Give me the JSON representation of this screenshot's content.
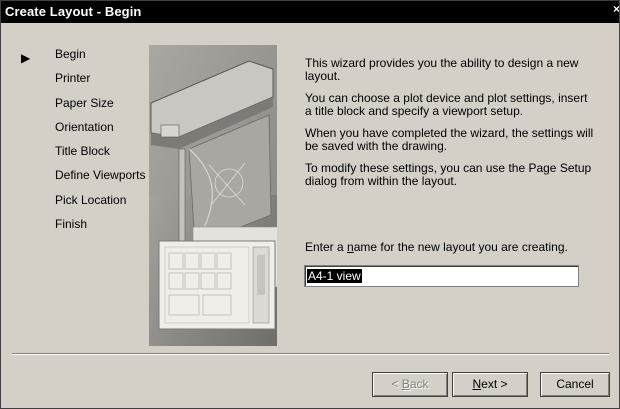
{
  "window": {
    "title": "Create Layout - Begin",
    "close_glyph": "×"
  },
  "steps": [
    {
      "label": "Begin",
      "current": true
    },
    {
      "label": "Printer"
    },
    {
      "label": "Paper Size"
    },
    {
      "label": "Orientation"
    },
    {
      "label": "Title Block"
    },
    {
      "label": "Define Viewports"
    },
    {
      "label": "Pick Location"
    },
    {
      "label": "Finish"
    }
  ],
  "current_marker": "▶",
  "main": {
    "paragraphs": [
      "This wizard provides you the ability to design a new layout.",
      "You can choose a plot device and plot settings, insert a title block and specify a viewport setup.",
      "When you have completed the wizard, the settings will be saved with the drawing.",
      "To modify these settings, you can use the Page Setup dialog from within the layout."
    ],
    "prompt": {
      "before": "Enter a ",
      "accel": "n",
      "after": "ame for the new layout you are creating."
    },
    "layout_name": "A4-1 view"
  },
  "buttons": {
    "back": {
      "accel": "B",
      "rest": "ack",
      "prefix": "< "
    },
    "next": {
      "accel": "N",
      "rest": "ext",
      "suffix": " >"
    },
    "cancel": "Cancel"
  },
  "colors": {
    "dialog_bg": "#d4d0c8",
    "titlebar_bg": "#000000",
    "disabled_text": "#808080"
  }
}
